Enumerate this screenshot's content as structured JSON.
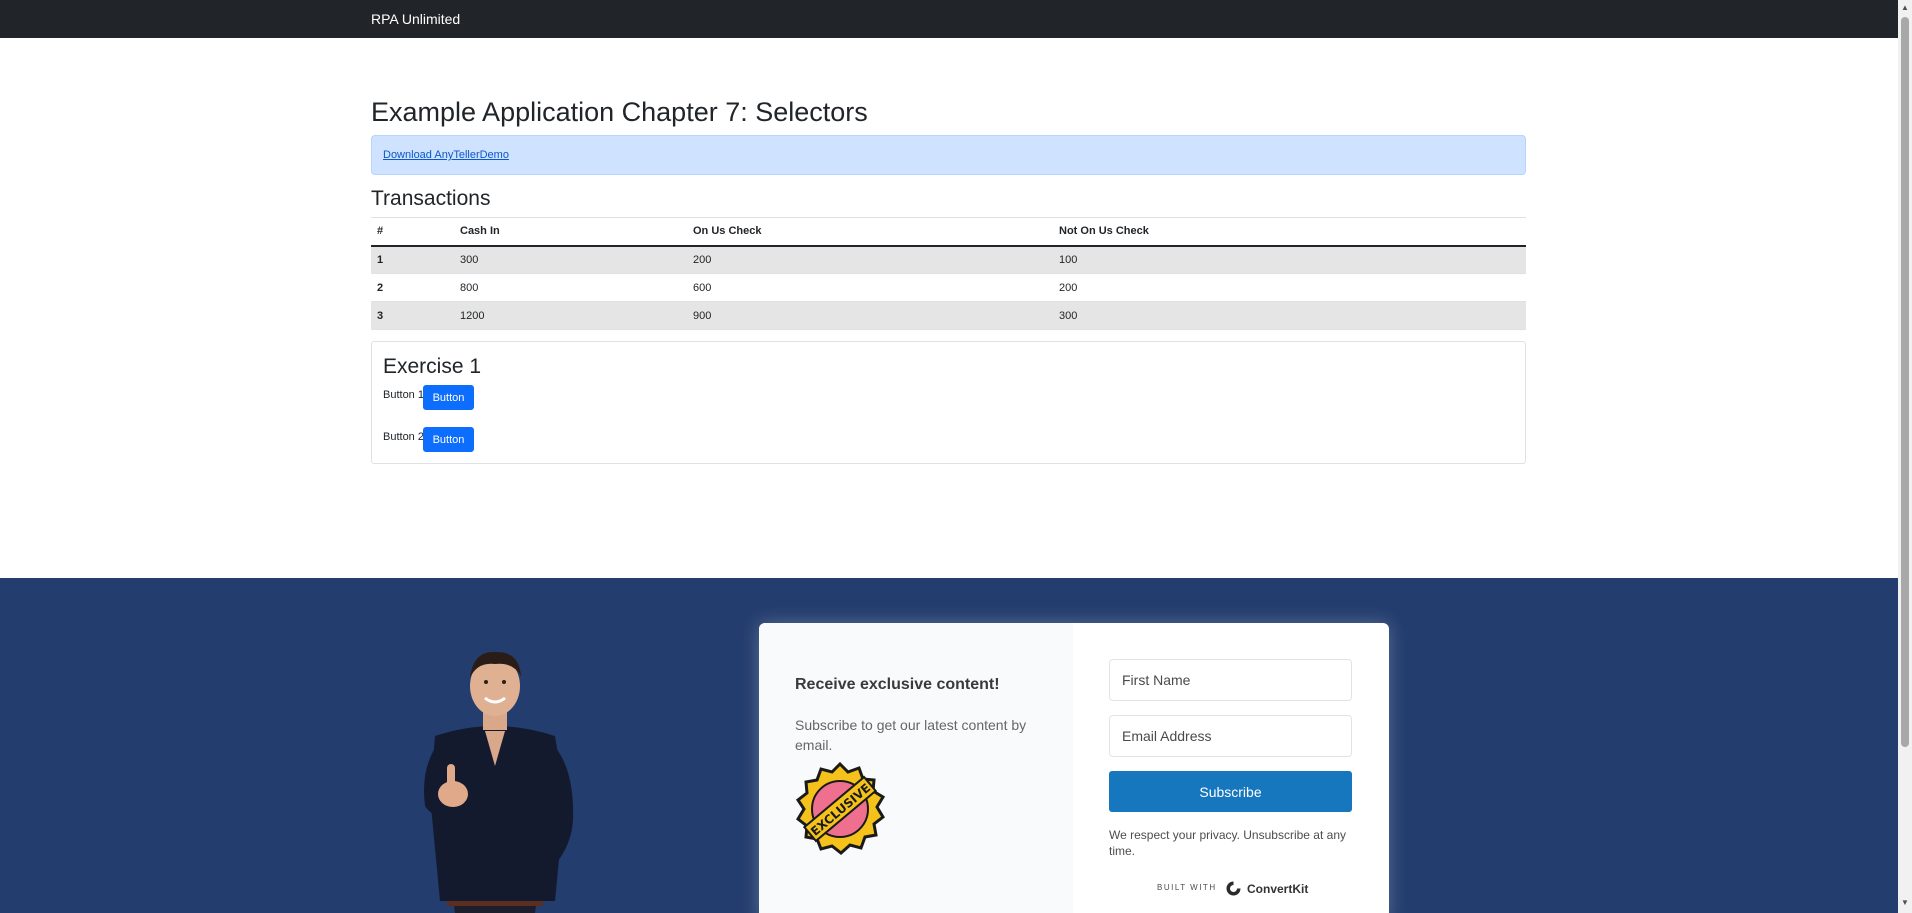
{
  "navbar": {
    "brand": "RPA Unlimited"
  },
  "page": {
    "title": "Example Application Chapter 7: Selectors",
    "download_link": "Download AnyTellerDemo"
  },
  "transactions": {
    "title": "Transactions",
    "headers": [
      "#",
      "Cash In",
      "On Us Check",
      "Not On Us Check"
    ],
    "rows": [
      [
        "1",
        "300",
        "200",
        "100"
      ],
      [
        "2",
        "800",
        "600",
        "200"
      ],
      [
        "3",
        "1200",
        "900",
        "300"
      ]
    ]
  },
  "exercise": {
    "title": "Exercise 1",
    "items": [
      {
        "label": "Button 1",
        "button": "Button"
      },
      {
        "label": "Button 2",
        "button": "Button"
      }
    ]
  },
  "signup": {
    "heading": "Receive exclusive content!",
    "subtext": "Subscribe to get our latest content by email.",
    "badge_text": "EXCLUSIVE",
    "first_name_placeholder": "First Name",
    "email_placeholder": "Email Address",
    "subscribe_label": "Subscribe",
    "privacy": "We respect your privacy. Unsubscribe at any time.",
    "built_with": "BUILT WITH",
    "brand": "ConvertKit"
  },
  "colors": {
    "navbar": "#212529",
    "primary": "#0d6efd",
    "footer": "#233d6e",
    "subscribe": "#1677be",
    "alert": "#cfe2ff"
  }
}
